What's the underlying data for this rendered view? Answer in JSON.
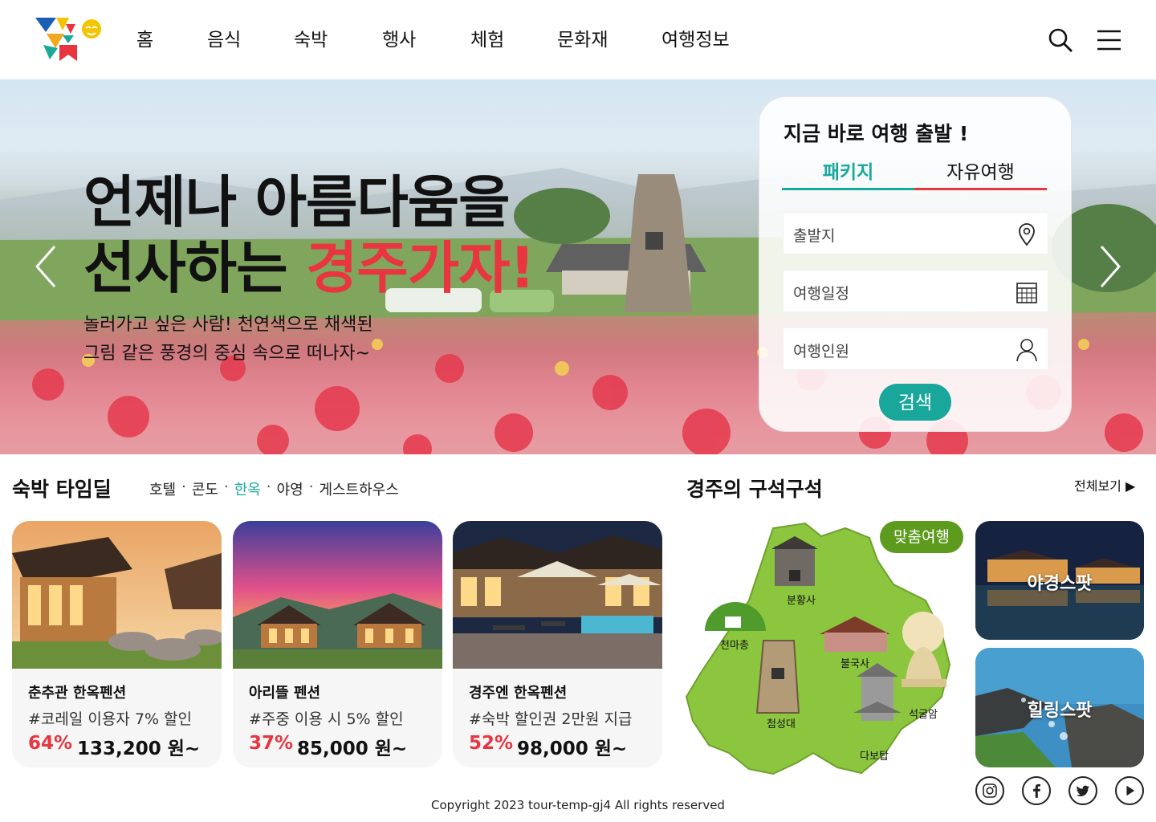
{
  "nav": {
    "items": [
      "홈",
      "음식",
      "숙박",
      "행사",
      "체험",
      "문화재",
      "여행정보"
    ]
  },
  "hero": {
    "title_line1": "언제나 아름다움을",
    "title_line2_prefix": "선사하는 ",
    "title_line2_accent": "경주가자!",
    "subtitle_line1": "놀러가고 싶은 사람! 천연색으로 채색된",
    "subtitle_line2": "그림 같은 풍경의 중심 속으로 떠나자~"
  },
  "search_panel": {
    "title": "지금 바로 여행 출발 !",
    "tabs": [
      "패키지",
      "자유여행"
    ],
    "fields": [
      {
        "placeholder": "출발지",
        "icon": "location-pin-icon"
      },
      {
        "placeholder": "여행일정",
        "icon": "calendar-icon"
      },
      {
        "placeholder": "여행인원",
        "icon": "user-icon"
      }
    ],
    "search_label": "검색"
  },
  "lodging": {
    "title": "숙박 타임딜",
    "categories": [
      "호텔",
      "콘도",
      "한옥",
      "야영",
      "게스트하우스"
    ],
    "active_category": "한옥",
    "separator": "·",
    "cards": [
      {
        "name": "춘추관 한옥펜션",
        "promo": "#코레일 이용자 7% 할인",
        "discount": "64%",
        "price": "133,200 원~"
      },
      {
        "name": "아리뜰 펜션",
        "promo": "#주중 이용 시 5% 할인",
        "discount": "37%",
        "price": "85,000 원~"
      },
      {
        "name": "경주엔 한옥펜션",
        "promo": "#숙박 할인권 2만원 지급",
        "discount": "52%",
        "price": "98,000 원~"
      }
    ]
  },
  "corners": {
    "title": "경주의 구석구석",
    "view_all": "전체보기 ▶",
    "tag": "맞춤여행",
    "landmarks": [
      "분황사",
      "천마총",
      "불국사",
      "첨성대",
      "석굴암",
      "다보탑"
    ],
    "spots": [
      "야경스팟",
      "힐링스팟"
    ]
  },
  "social": [
    "instagram-icon",
    "facebook-icon",
    "twitter-icon",
    "youtube-icon"
  ],
  "footer": {
    "copyright": "Copyright 2023 tour-temp-gj4 All rights reserved"
  },
  "colors": {
    "accent_red": "#e8353f",
    "accent_teal": "#18a99c",
    "tag_green": "#5c9b1e",
    "map_green": "#8cc63f"
  }
}
